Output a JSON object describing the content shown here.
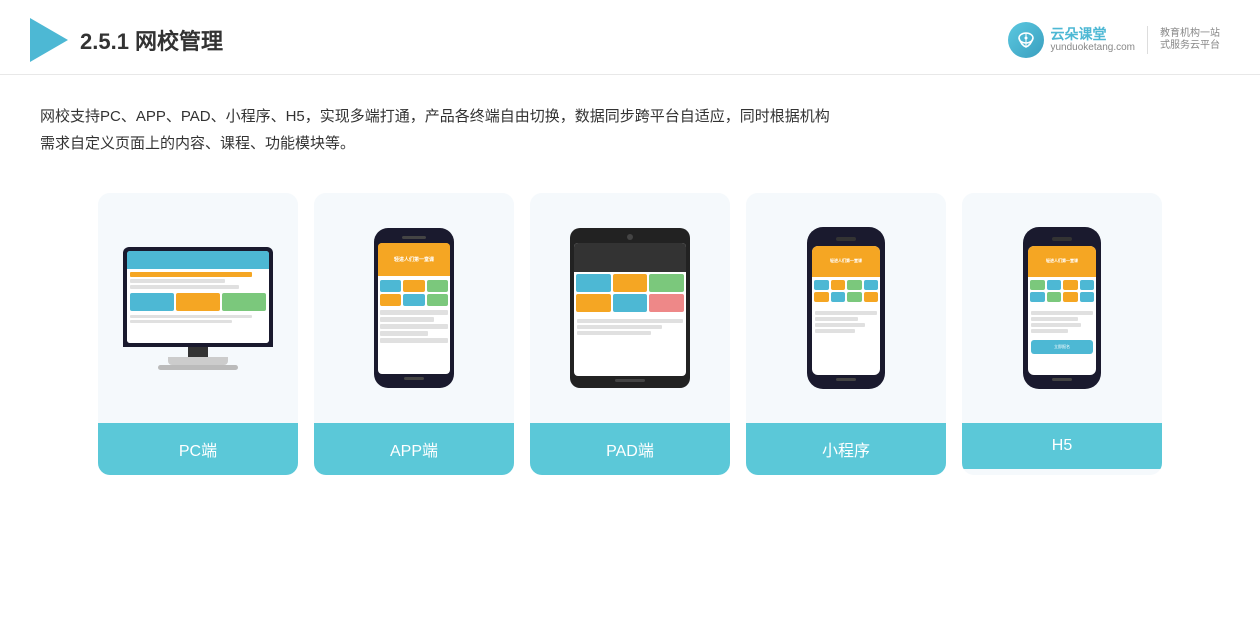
{
  "header": {
    "title_prefix": "2.5.1 ",
    "title_main": "网校管理",
    "brand_name": "云朵课堂",
    "brand_url": "yunduoketang.com",
    "brand_slogan_line1": "教育机构一站",
    "brand_slogan_line2": "式服务云平台"
  },
  "description": {
    "text_line1": "网校支持PC、APP、PAD、小程序、H5，实现多端打通，产品各终端自由切换，数据同步跨平台自适应，同时根据机构",
    "text_line2": "需求自定义页面上的内容、课程、功能模块等。"
  },
  "cards": [
    {
      "id": "pc",
      "label": "PC端"
    },
    {
      "id": "app",
      "label": "APP端"
    },
    {
      "id": "pad",
      "label": "PAD端"
    },
    {
      "id": "miniprogram",
      "label": "小程序"
    },
    {
      "id": "h5",
      "label": "H5"
    }
  ]
}
